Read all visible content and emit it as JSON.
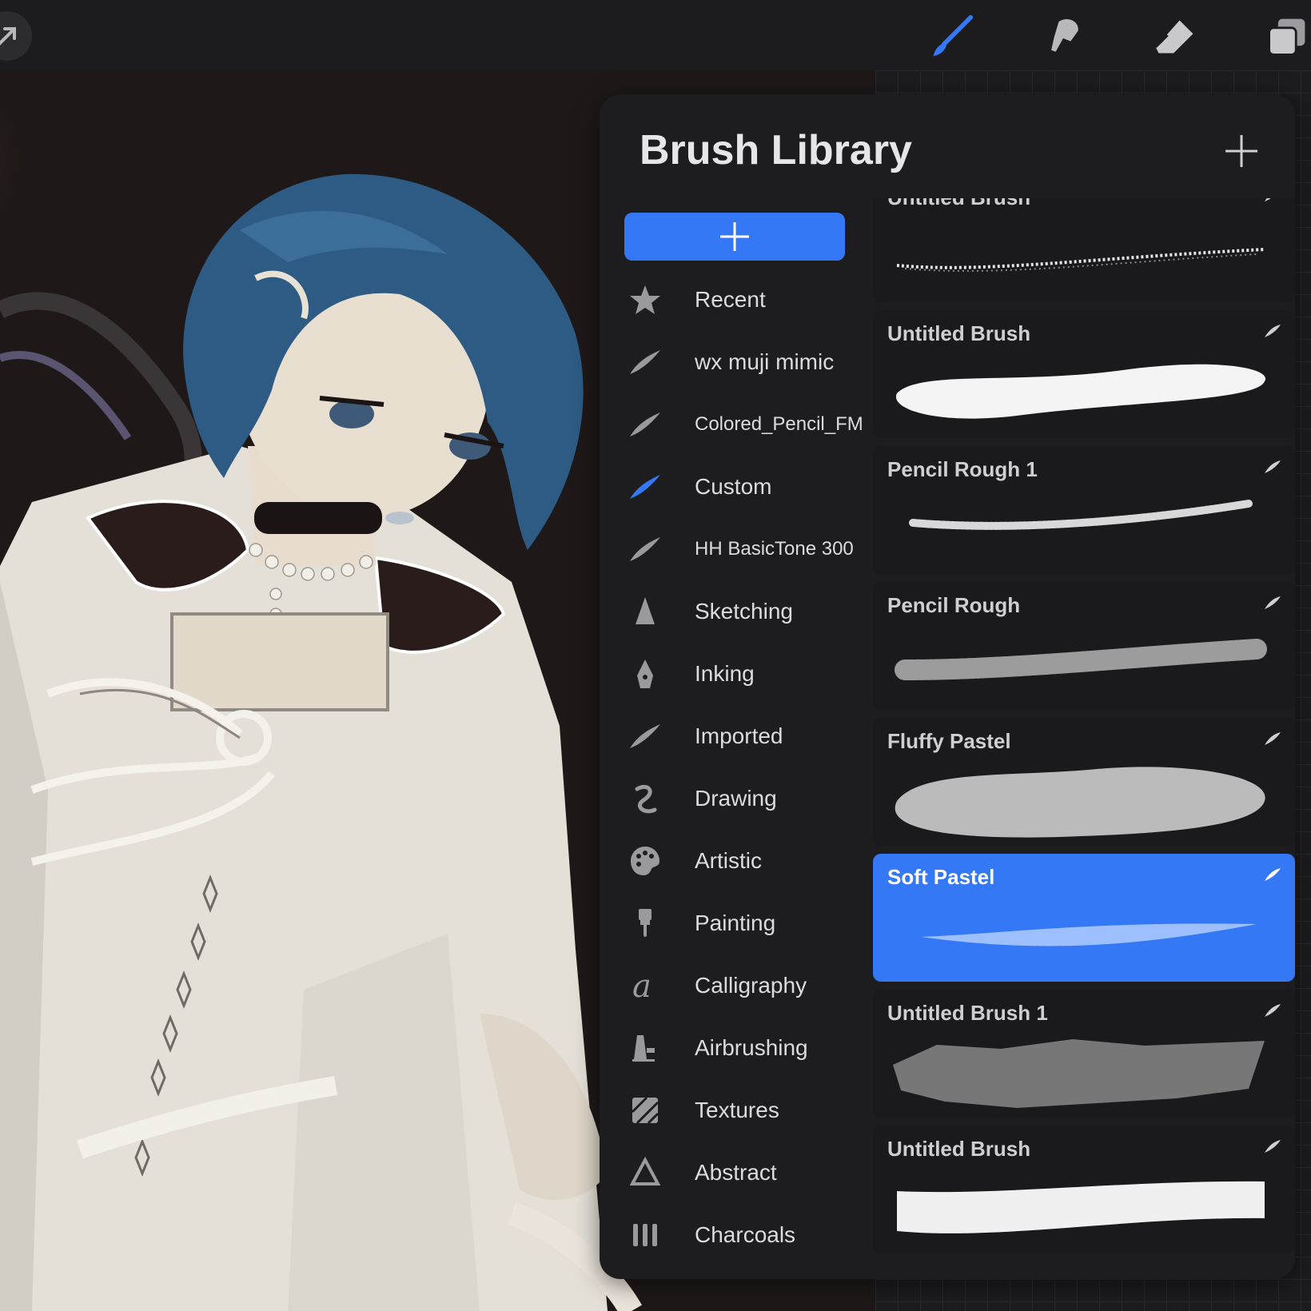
{
  "colors": {
    "accent": "#3478f6",
    "panel_bg": "#1d1d1f",
    "text": "#dcdcde"
  },
  "toolbar": {
    "tools": [
      {
        "name": "brush-tool",
        "icon": "brush-icon",
        "active": true
      },
      {
        "name": "smudge-tool",
        "icon": "smudge-icon",
        "active": false
      },
      {
        "name": "eraser-tool",
        "icon": "eraser-icon",
        "active": false
      },
      {
        "name": "layers-tool",
        "icon": "layers-icon",
        "active": false
      }
    ]
  },
  "library": {
    "title": "Brush Library",
    "categories": [
      {
        "label": "Recent",
        "icon": "star-icon"
      },
      {
        "label": "wx muji mimic",
        "icon": "brush-stroke-icon"
      },
      {
        "label": "Colored_Pencil_FM",
        "icon": "brush-stroke-icon"
      },
      {
        "label": "Custom",
        "icon": "brush-stroke-icon",
        "selected": true
      },
      {
        "label": "HH BasicTone 300",
        "icon": "brush-stroke-icon"
      },
      {
        "label": "Sketching",
        "icon": "pencil-tip-icon"
      },
      {
        "label": "Inking",
        "icon": "pen-nib-icon"
      },
      {
        "label": "Imported",
        "icon": "brush-stroke-icon"
      },
      {
        "label": "Drawing",
        "icon": "squiggle-icon"
      },
      {
        "label": "Artistic",
        "icon": "palette-icon"
      },
      {
        "label": "Painting",
        "icon": "paintbrush-icon"
      },
      {
        "label": "Calligraphy",
        "icon": "calligraphy-icon"
      },
      {
        "label": "Airbrushing",
        "icon": "airbrush-icon"
      },
      {
        "label": "Textures",
        "icon": "texture-icon"
      },
      {
        "label": "Abstract",
        "icon": "triangle-icon"
      },
      {
        "label": "Charcoals",
        "icon": "charcoal-icon"
      }
    ],
    "brushes": [
      {
        "name": "Untitled Brush",
        "stroke": "thin-dotted"
      },
      {
        "name": "Untitled Brush",
        "stroke": "thick-white"
      },
      {
        "name": "Pencil Rough 1",
        "stroke": "beaded"
      },
      {
        "name": "Pencil Rough",
        "stroke": "grainy"
      },
      {
        "name": "Fluffy Pastel",
        "stroke": "fluffy"
      },
      {
        "name": "Soft Pastel",
        "stroke": "soft",
        "selected": true
      },
      {
        "name": "Untitled Brush 1",
        "stroke": "shards"
      },
      {
        "name": "Untitled Brush",
        "stroke": "ribbon"
      }
    ]
  }
}
